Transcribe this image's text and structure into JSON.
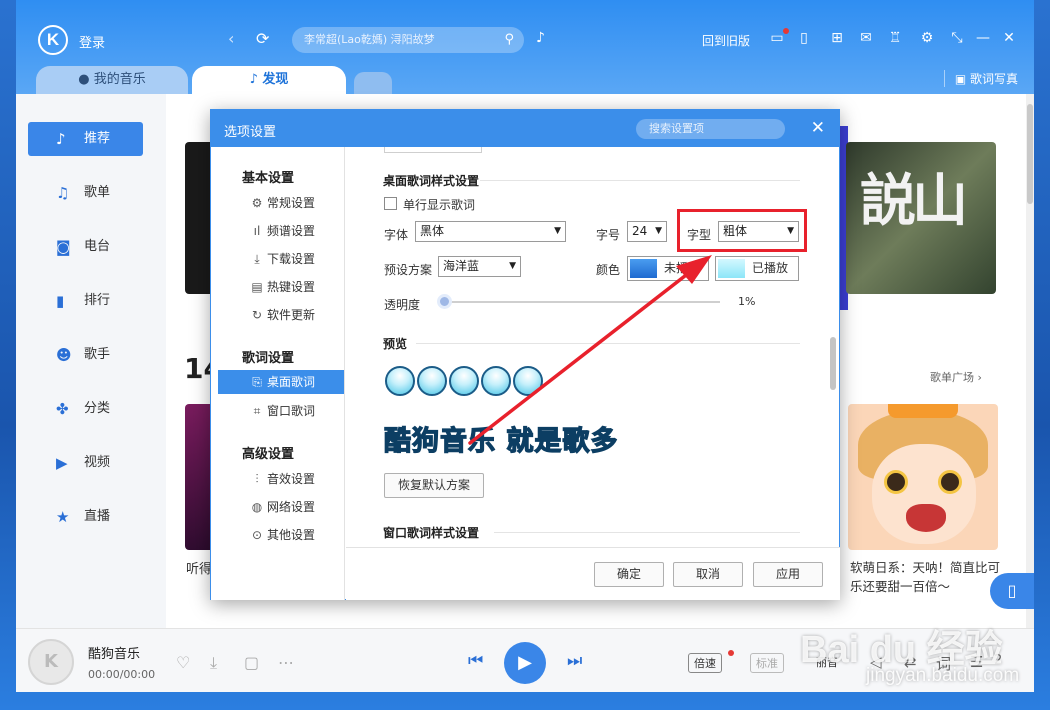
{
  "app": {
    "login": "登录",
    "search_placeholder": "李常超(Lao乾媽) 浔阳故梦",
    "old_version": "回到旧版",
    "tabs": {
      "my_music": "我的音乐",
      "discover": "发现"
    },
    "lyrics_write": "歌词写真"
  },
  "sidebar": {
    "items": [
      {
        "label": "推荐",
        "icon": "music-note-icon"
      },
      {
        "label": "歌单",
        "icon": "playlist-icon"
      },
      {
        "label": "电台",
        "icon": "radio-icon"
      },
      {
        "label": "排行",
        "icon": "chart-icon"
      },
      {
        "label": "歌手",
        "icon": "singer-icon"
      },
      {
        "label": "分类",
        "icon": "category-icon"
      },
      {
        "label": "视频",
        "icon": "video-icon"
      },
      {
        "label": "直播",
        "icon": "live-icon"
      }
    ]
  },
  "content": {
    "section_number": "14",
    "playlist_link": "歌单广场 ›",
    "card_left_caption": "听得",
    "card_right_caption": "软萌日系：天呐！简直比可乐还要甜一百倍～"
  },
  "player": {
    "song": "酷狗音乐",
    "time": "00:00/00:00",
    "speed": "倍速",
    "quality": "标准",
    "voice": "丽音",
    "lyric": "词",
    "count": "2"
  },
  "dialog": {
    "title": "选项设置",
    "search_placeholder": "搜索设置项",
    "nav": {
      "group_basic": "基本设置",
      "basic_items": [
        "常规设置",
        "频谱设置",
        "下载设置",
        "热键设置",
        "软件更新"
      ],
      "group_lyrics": "歌词设置",
      "lyrics_items": [
        "桌面歌词",
        "窗口歌词"
      ],
      "group_advanced": "高级设置",
      "advanced_items": [
        "音效设置",
        "网络设置",
        "其他设置"
      ]
    },
    "desktop_lyrics": {
      "section_title": "桌面歌词样式设置",
      "single_line_label": "单行显示歌词",
      "single_line_checked": false,
      "font_label": "字体",
      "font_value": "黑体",
      "size_label": "字号",
      "size_value": "24",
      "style_label": "字型",
      "style_value": "粗体",
      "preset_label": "预设方案",
      "preset_value": "海洋蓝",
      "color_label": "颜色",
      "unplayed_label": "未播放",
      "played_label": "已播放",
      "opacity_label": "透明度",
      "opacity_value": "1%",
      "preview_label": "预览",
      "preview_text": "酷狗音乐  就是歌多",
      "restore_button": "恢复默认方案"
    },
    "window_lyrics": {
      "section_title": "窗口歌词样式设置"
    },
    "footer": {
      "ok": "确定",
      "cancel": "取消",
      "apply": "应用"
    }
  },
  "watermark": {
    "brand": "Bai du 经验",
    "url": "jingyan.baidu.com"
  },
  "colors": {
    "accent": "#3b8eea",
    "highlight_red": "#e8212c",
    "unplayed_color": "#1f6ad0",
    "played_color": "#8ce6f8",
    "preview_fill": "#1a7fc4"
  }
}
